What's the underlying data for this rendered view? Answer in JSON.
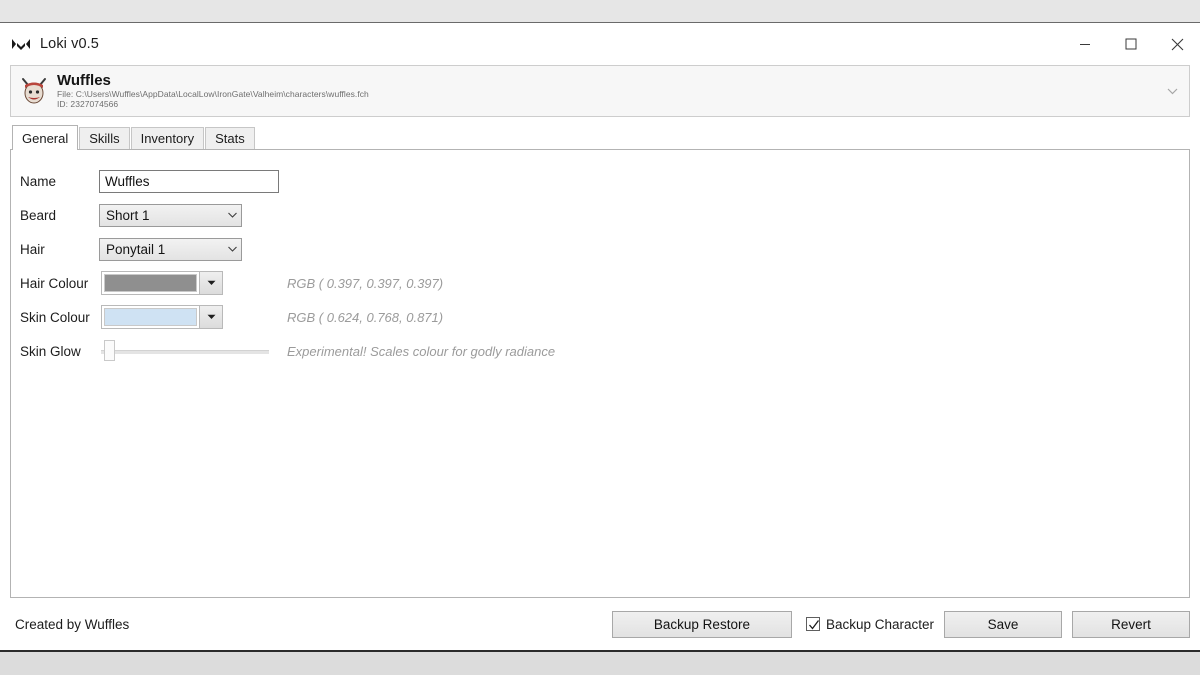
{
  "window": {
    "title": "Loki v0.5",
    "icon": "loki-logo-icon",
    "controls": {
      "minimize": "minimize-icon",
      "maximize": "maximize-icon",
      "close": "close-icon"
    }
  },
  "character_panel": {
    "avatar": "viking-face-icon",
    "name": "Wuffles",
    "file_line": "File: C:\\Users\\Wuffles\\AppData\\LocalLow\\IronGate\\Valheim\\characters\\wuffles.fch",
    "id_line": "ID: 2327074566",
    "expander": "chevron-down-icon"
  },
  "tabs": [
    {
      "label": "General",
      "active": true
    },
    {
      "label": "Skills",
      "active": false
    },
    {
      "label": "Inventory",
      "active": false
    },
    {
      "label": "Stats",
      "active": false
    }
  ],
  "general": {
    "name": {
      "label": "Name",
      "value": "Wuffles",
      "placeholder": ""
    },
    "beard": {
      "label": "Beard",
      "value": "Short 1"
    },
    "hair": {
      "label": "Hair",
      "value": "Ponytail 1"
    },
    "hair_colour": {
      "label": "Hair Colour",
      "swatch": "#8f8f8f",
      "rgb_text": "RGB ( 0.397, 0.397, 0.397)"
    },
    "skin_colour": {
      "label": "Skin Colour",
      "swatch": "#cfe2f3",
      "rgb_text": "RGB ( 0.624, 0.768, 0.871)"
    },
    "skin_glow": {
      "label": "Skin Glow",
      "value": 0,
      "hint": "Experimental! Scales colour for godly radiance"
    }
  },
  "footer": {
    "credits": "Created by Wuffles",
    "backup_restore_label": "Backup Restore",
    "backup_character_label": "Backup Character",
    "backup_character_checked": true,
    "save_label": "Save",
    "revert_label": "Revert"
  }
}
